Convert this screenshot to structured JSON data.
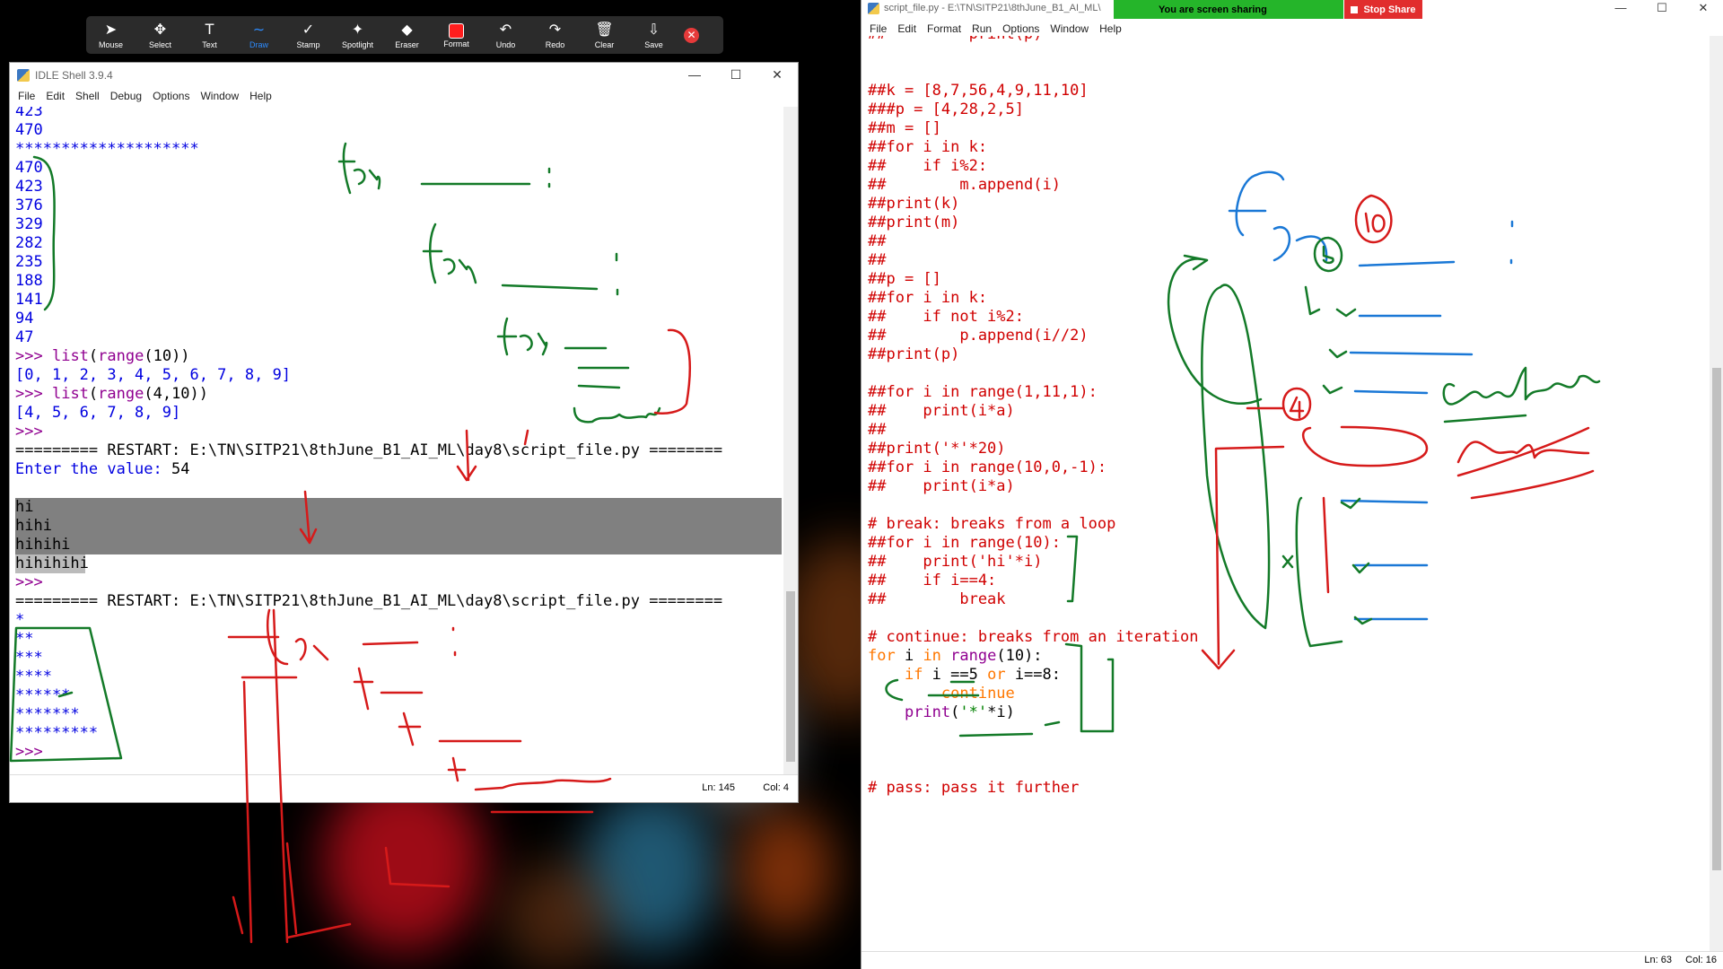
{
  "toolbar": {
    "tools": [
      {
        "name": "Mouse",
        "icon": "mouse-pointer-icon"
      },
      {
        "name": "Select",
        "icon": "move-arrows-icon"
      },
      {
        "name": "Text",
        "icon": "text-t-icon"
      },
      {
        "name": "Draw",
        "icon": "draw-squiggle-icon",
        "active": true
      },
      {
        "name": "Stamp",
        "icon": "checkmark-icon"
      },
      {
        "name": "Spotlight",
        "icon": "spotlight-wand-icon"
      },
      {
        "name": "Eraser",
        "icon": "eraser-icon"
      },
      {
        "name": "Format",
        "icon": "format-color-icon"
      },
      {
        "name": "Undo",
        "icon": "undo-icon"
      },
      {
        "name": "Redo",
        "icon": "redo-icon"
      },
      {
        "name": "Clear",
        "icon": "trash-icon"
      },
      {
        "name": "Save",
        "icon": "save-download-icon"
      }
    ]
  },
  "shell": {
    "title": "IDLE Shell 3.9.4",
    "menus": [
      "File",
      "Edit",
      "Shell",
      "Debug",
      "Options",
      "Window",
      "Help"
    ],
    "status_ln": "Ln: 145",
    "status_col": "Col: 4",
    "lines": [
      {
        "t": "423",
        "c": "blue"
      },
      {
        "t": "470",
        "c": "blue"
      },
      {
        "t": "********************",
        "c": "blue"
      },
      {
        "t": "470",
        "c": "blue"
      },
      {
        "t": "423",
        "c": "blue"
      },
      {
        "t": "376",
        "c": "blue"
      },
      {
        "t": "329",
        "c": "blue"
      },
      {
        "t": "282",
        "c": "blue"
      },
      {
        "t": "235",
        "c": "blue"
      },
      {
        "t": "188",
        "c": "blue"
      },
      {
        "t": "141",
        "c": "blue"
      },
      {
        "t": "94",
        "c": "blue"
      },
      {
        "t": "47",
        "c": "blue"
      },
      {
        "t": ">>> list(range(10))",
        "c": "prompt"
      },
      {
        "t": "[0, 1, 2, 3, 4, 5, 6, 7, 8, 9]",
        "c": "blue"
      },
      {
        "t": ">>> list(range(4,10))",
        "c": "prompt"
      },
      {
        "t": "[4, 5, 6, 7, 8, 9]",
        "c": "blue"
      },
      {
        "t": ">>>",
        "c": "prompt"
      },
      {
        "t": "========= RESTART: E:\\TN\\SITP21\\8thJune_B1_AI_ML\\day8\\script_file.py ========",
        "c": "black"
      },
      {
        "t": "Enter the value: 54",
        "c": "input"
      },
      {
        "t": "",
        "c": "blue"
      },
      {
        "t": "hi",
        "c": "sel"
      },
      {
        "t": "hihi",
        "c": "sel"
      },
      {
        "t": "hihihi",
        "c": "sel"
      },
      {
        "t": "hihihihi",
        "c": "sellast"
      },
      {
        "t": ">>>",
        "c": "prompt"
      },
      {
        "t": "========= RESTART: E:\\TN\\SITP21\\8thJune_B1_AI_ML\\day8\\script_file.py ========",
        "c": "black"
      },
      {
        "t": "*",
        "c": "blue"
      },
      {
        "t": "**",
        "c": "blue"
      },
      {
        "t": "***",
        "c": "blue"
      },
      {
        "t": "****",
        "c": "blue"
      },
      {
        "t": "******",
        "c": "blue"
      },
      {
        "t": "*******",
        "c": "blue"
      },
      {
        "t": "*********",
        "c": "blue"
      },
      {
        "t": ">>>",
        "c": "prompt"
      }
    ]
  },
  "editor": {
    "title": "script_file.py - E:\\TN\\SITP21\\8thJune_B1_AI_ML\\",
    "menus": [
      "File",
      "Edit",
      "Format",
      "Run",
      "Options",
      "Window",
      "Help"
    ],
    "status_ln": "Ln: 63",
    "status_col": "Col: 16",
    "lines": [
      {
        "t": "##         print(p) ",
        "c": "red"
      },
      {
        "t": "",
        "c": "red"
      },
      {
        "t": "",
        "c": "red"
      },
      {
        "t": "##k = [8,7,56,4,9,11,10]",
        "c": "red"
      },
      {
        "t": "###p = [4,28,2,5]",
        "c": "red"
      },
      {
        "t": "##m = []",
        "c": "red"
      },
      {
        "t": "##for i in k:",
        "c": "red"
      },
      {
        "t": "##    if i%2:",
        "c": "red"
      },
      {
        "t": "##        m.append(i)",
        "c": "red"
      },
      {
        "t": "##print(k)",
        "c": "red"
      },
      {
        "t": "##print(m)",
        "c": "red"
      },
      {
        "t": "##",
        "c": "red"
      },
      {
        "t": "##",
        "c": "red"
      },
      {
        "t": "##p = []",
        "c": "red"
      },
      {
        "t": "##for i in k:",
        "c": "red"
      },
      {
        "t": "##    if not i%2:",
        "c": "red"
      },
      {
        "t": "##        p.append(i//2)",
        "c": "red"
      },
      {
        "t": "##print(p)",
        "c": "red"
      },
      {
        "t": "",
        "c": "red"
      },
      {
        "t": "##for i in range(1,11,1):",
        "c": "red"
      },
      {
        "t": "##    print(i*a)",
        "c": "red"
      },
      {
        "t": "##",
        "c": "red"
      },
      {
        "t": "##print('*'*20)",
        "c": "red"
      },
      {
        "t": "##for i in range(10,0,-1):",
        "c": "red"
      },
      {
        "t": "##    print(i*a)",
        "c": "red"
      },
      {
        "t": "",
        "c": "red"
      },
      {
        "t": "# break: breaks from a loop",
        "c": "red"
      },
      {
        "t": "##for i in range(10):",
        "c": "red"
      },
      {
        "t": "##    print('hi'*i)",
        "c": "red"
      },
      {
        "t": "##    if i==4:",
        "c": "red"
      },
      {
        "t": "##        break",
        "c": "red"
      },
      {
        "t": "",
        "c": "red"
      },
      {
        "t": "# continue: breaks from an iteration",
        "c": "red"
      },
      {
        "t": "for i in range(10):",
        "c": "code1"
      },
      {
        "t": "    if i ==5 or i==8:",
        "c": "code2"
      },
      {
        "t": "        continue",
        "c": "code3"
      },
      {
        "t": "    print('*'*i)",
        "c": "code4"
      },
      {
        "t": "",
        "c": "red"
      },
      {
        "t": "",
        "c": "red"
      },
      {
        "t": "",
        "c": "red"
      },
      {
        "t": "# pass: pass it further",
        "c": "red"
      }
    ]
  },
  "share": {
    "banner_text": "You are screen sharing",
    "stop_label": "Stop Share"
  }
}
